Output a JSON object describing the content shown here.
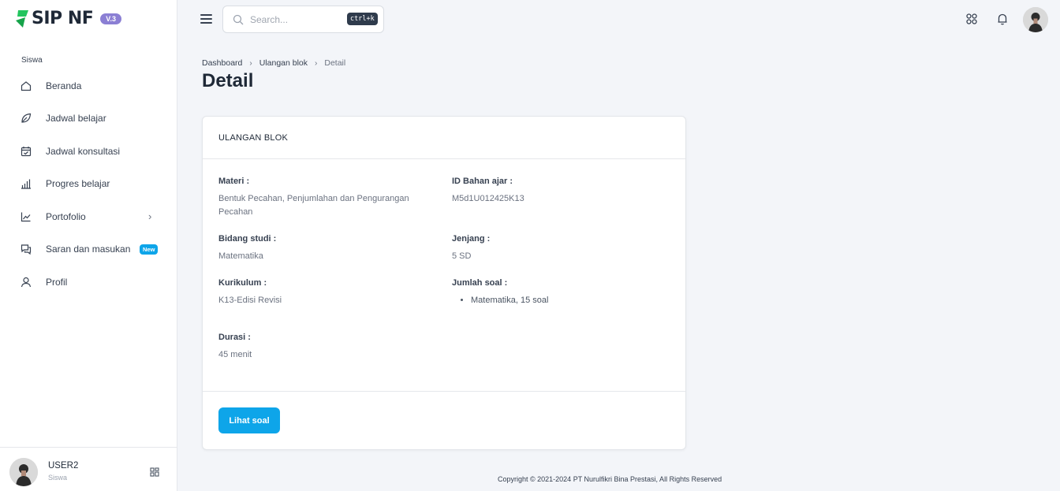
{
  "app": {
    "logo_text": "SIP NF",
    "version_badge": "V.3"
  },
  "sidebar": {
    "section_label": "Siswa",
    "items": [
      {
        "label": "Beranda",
        "icon": "home-icon"
      },
      {
        "label": "Jadwal belajar",
        "icon": "leaf-icon"
      },
      {
        "label": "Jadwal konsultasi",
        "icon": "calendar-check-icon"
      },
      {
        "label": "Progres belajar",
        "icon": "bar-chart-icon"
      },
      {
        "label": "Portofolio",
        "icon": "line-chart-icon",
        "chevron": "›"
      },
      {
        "label": "Saran dan masukan",
        "icon": "chat-icon",
        "badge": "New"
      },
      {
        "label": "Profil",
        "icon": "user-icon"
      }
    ],
    "user": {
      "name": "USER2",
      "role": "Siswa"
    }
  },
  "topbar": {
    "search_placeholder": "Search...",
    "shortcut": "ctrl+k"
  },
  "breadcrumb": {
    "items": [
      "Dashboard",
      "Ulangan blok",
      "Detail"
    ],
    "separator": "›"
  },
  "page": {
    "title": "Detail"
  },
  "card": {
    "header": "ULANGAN BLOK",
    "fields": {
      "materi": {
        "label": "Materi :",
        "value": "Bentuk Pecahan, Penjumlahan dan Pengurangan Pecahan"
      },
      "id_bahan_ajar": {
        "label": "ID Bahan ajar :",
        "value": "M5d1U012425K13"
      },
      "bidang_studi": {
        "label": "Bidang studi :",
        "value": "Matematika"
      },
      "jenjang": {
        "label": "Jenjang :",
        "value": "5 SD"
      },
      "kurikulum": {
        "label": "Kurikulum :",
        "value": "K13-Edisi Revisi"
      },
      "jumlah_soal": {
        "label": "Jumlah soal :",
        "items": [
          "Matematika, 15 soal"
        ]
      },
      "durasi": {
        "label": "Durasi :",
        "value": "45 menit"
      }
    },
    "button_label": "Lihat soal"
  },
  "footer": {
    "copyright": "Copyright © 2021-2024 PT Nurulfikri Bina Prestasi, All Rights Reserved"
  },
  "colors": {
    "accent": "#0ea5e9",
    "logo_green": "#22c55e",
    "badge_purple": "#8b7fd4",
    "background": "#f3f5f9"
  }
}
